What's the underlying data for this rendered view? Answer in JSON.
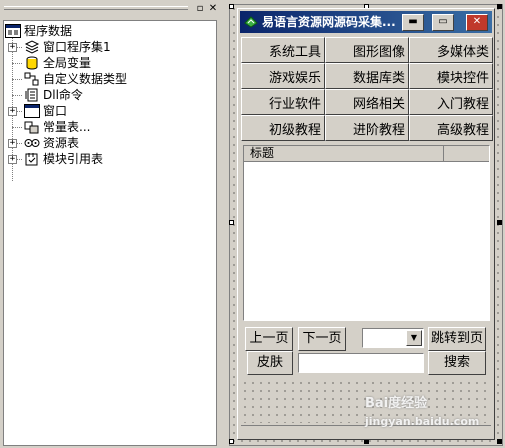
{
  "panel": {
    "pin_glyph": "▫",
    "close_glyph": "✕"
  },
  "tree": {
    "root_label": "程序数据",
    "items": [
      {
        "label": "窗口程序集1",
        "icon": "module-icon"
      },
      {
        "label": "全局变量",
        "icon": "variable-icon"
      },
      {
        "label": "自定义数据类型",
        "icon": "datatype-icon"
      },
      {
        "label": "Dll命令",
        "icon": "dll-icon"
      },
      {
        "label": "窗口",
        "icon": "window-icon"
      },
      {
        "label": "常量表...",
        "icon": "constant-icon"
      },
      {
        "label": "资源表",
        "icon": "resource-icon"
      },
      {
        "label": "模块引用表",
        "icon": "module-ref-icon"
      }
    ]
  },
  "form": {
    "title": "易语言资源网源码采集...",
    "min_glyph": "▬",
    "max_glyph": "▭",
    "close_glyph": "✕",
    "categories": [
      "系统工具",
      "图形图像",
      "多媒体类",
      "游戏娱乐",
      "数据库类",
      "模块控件",
      "行业软件",
      "网络相关",
      "入门教程",
      "初级教程",
      "进阶教程",
      "高级教程"
    ],
    "list_header": "标题",
    "prev_page": "上一页",
    "next_page": "下一页",
    "combo_arrow": "▼",
    "jump_page": "跳转到页",
    "skin": "皮肤",
    "search": "搜索",
    "search_value": ""
  },
  "watermark": {
    "line1": "Bai度经验",
    "line2": "jingyan.baidu.com"
  },
  "colors": {
    "title_bar": "#0a246a",
    "close_button": "#c0392b"
  }
}
